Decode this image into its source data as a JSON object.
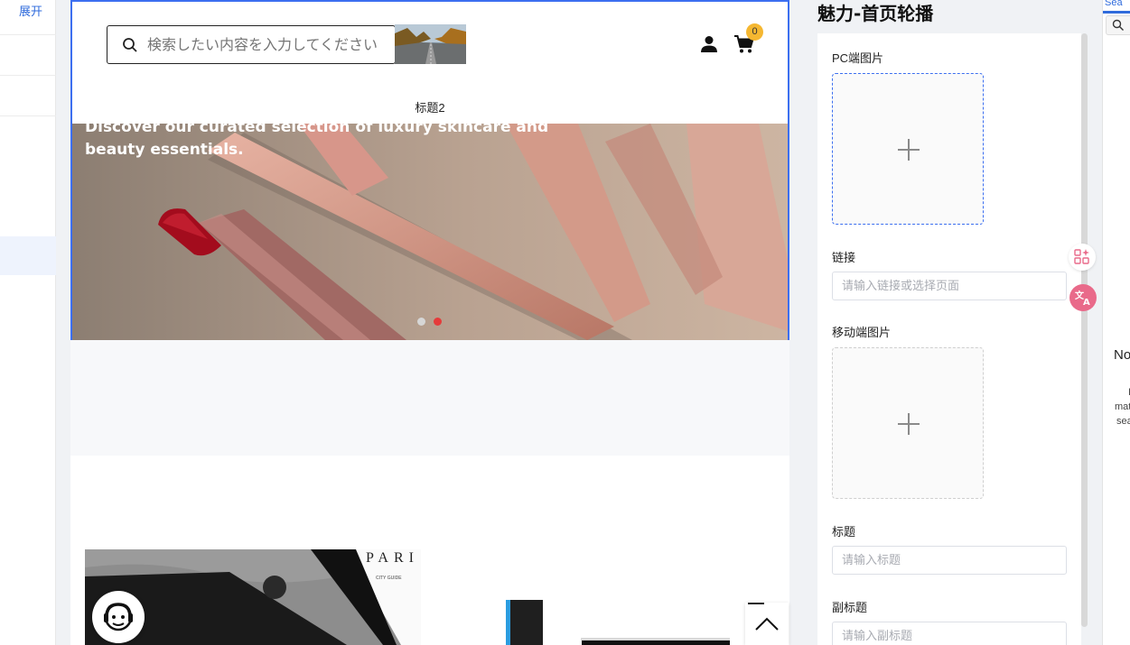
{
  "left_nav": {
    "expand_label": "展开"
  },
  "site": {
    "search_placeholder": "検索したい内容を入力してください",
    "cart_count": "0",
    "nav_title": "标题2",
    "banner_text": "Discover our curated selection of luxury skincare and beauty essentials.",
    "slides_total": 2,
    "active_slide": 2
  },
  "panel": {
    "title": "魅力-首页轮播",
    "pc_image_label": "PC端图片",
    "link_label": "链接",
    "link_placeholder": "请输入链接或选择页面",
    "mobile_image_label": "移动端图片",
    "title_label": "标题",
    "title_placeholder": "请输入标题",
    "subtitle_label": "副标题",
    "subtitle_placeholder": "请输入副标题"
  },
  "far_right": {
    "tab_label": "Sea",
    "no_text": "No",
    "line1": "I",
    "line2": "mat",
    "line3": "sea"
  },
  "icons": {
    "search": "search-icon",
    "user": "user-icon",
    "cart": "cart-icon",
    "service": "customer-service-icon",
    "backtop": "chevron-up-icon",
    "ai": "ai-apps-icon",
    "translate": "translate-icon"
  },
  "colors": {
    "accent": "#3c6ff0",
    "badge": "#f5b731",
    "active_dot": "#e53b3b",
    "translate_btn": "#e96a8a"
  }
}
